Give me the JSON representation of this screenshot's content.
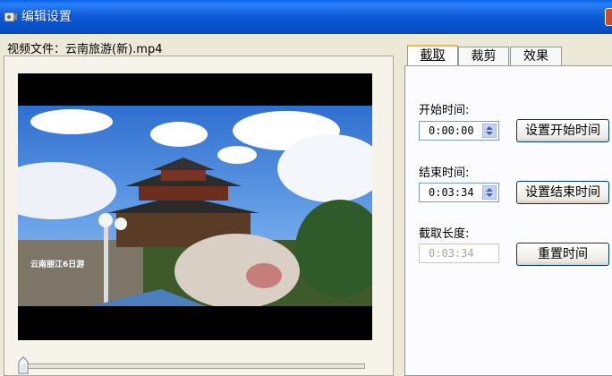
{
  "window": {
    "title": "编辑设置"
  },
  "file": {
    "label": "视频文件：",
    "name": "云南旅游(新).mp4"
  },
  "tabs": [
    {
      "label": "截取",
      "active": true
    },
    {
      "label": "裁剪",
      "active": false
    },
    {
      "label": "效果",
      "active": false
    }
  ],
  "trim": {
    "start_label": "开始时间:",
    "start_value": "0:00:00",
    "set_start_button": "设置开始时间",
    "end_label": "结束时间:",
    "end_value": "0:03:34",
    "set_end_button": "设置结束时间",
    "length_label": "截取长度:",
    "length_value": "0:03:34",
    "reset_button": "重置时间"
  },
  "video": {
    "caption": "云南丽江6日游",
    "position_fraction": 0.0
  },
  "colors": {
    "titlebar": "#0A5ADA",
    "accent_tab": "#F3B74A",
    "close": "#D4472A"
  }
}
